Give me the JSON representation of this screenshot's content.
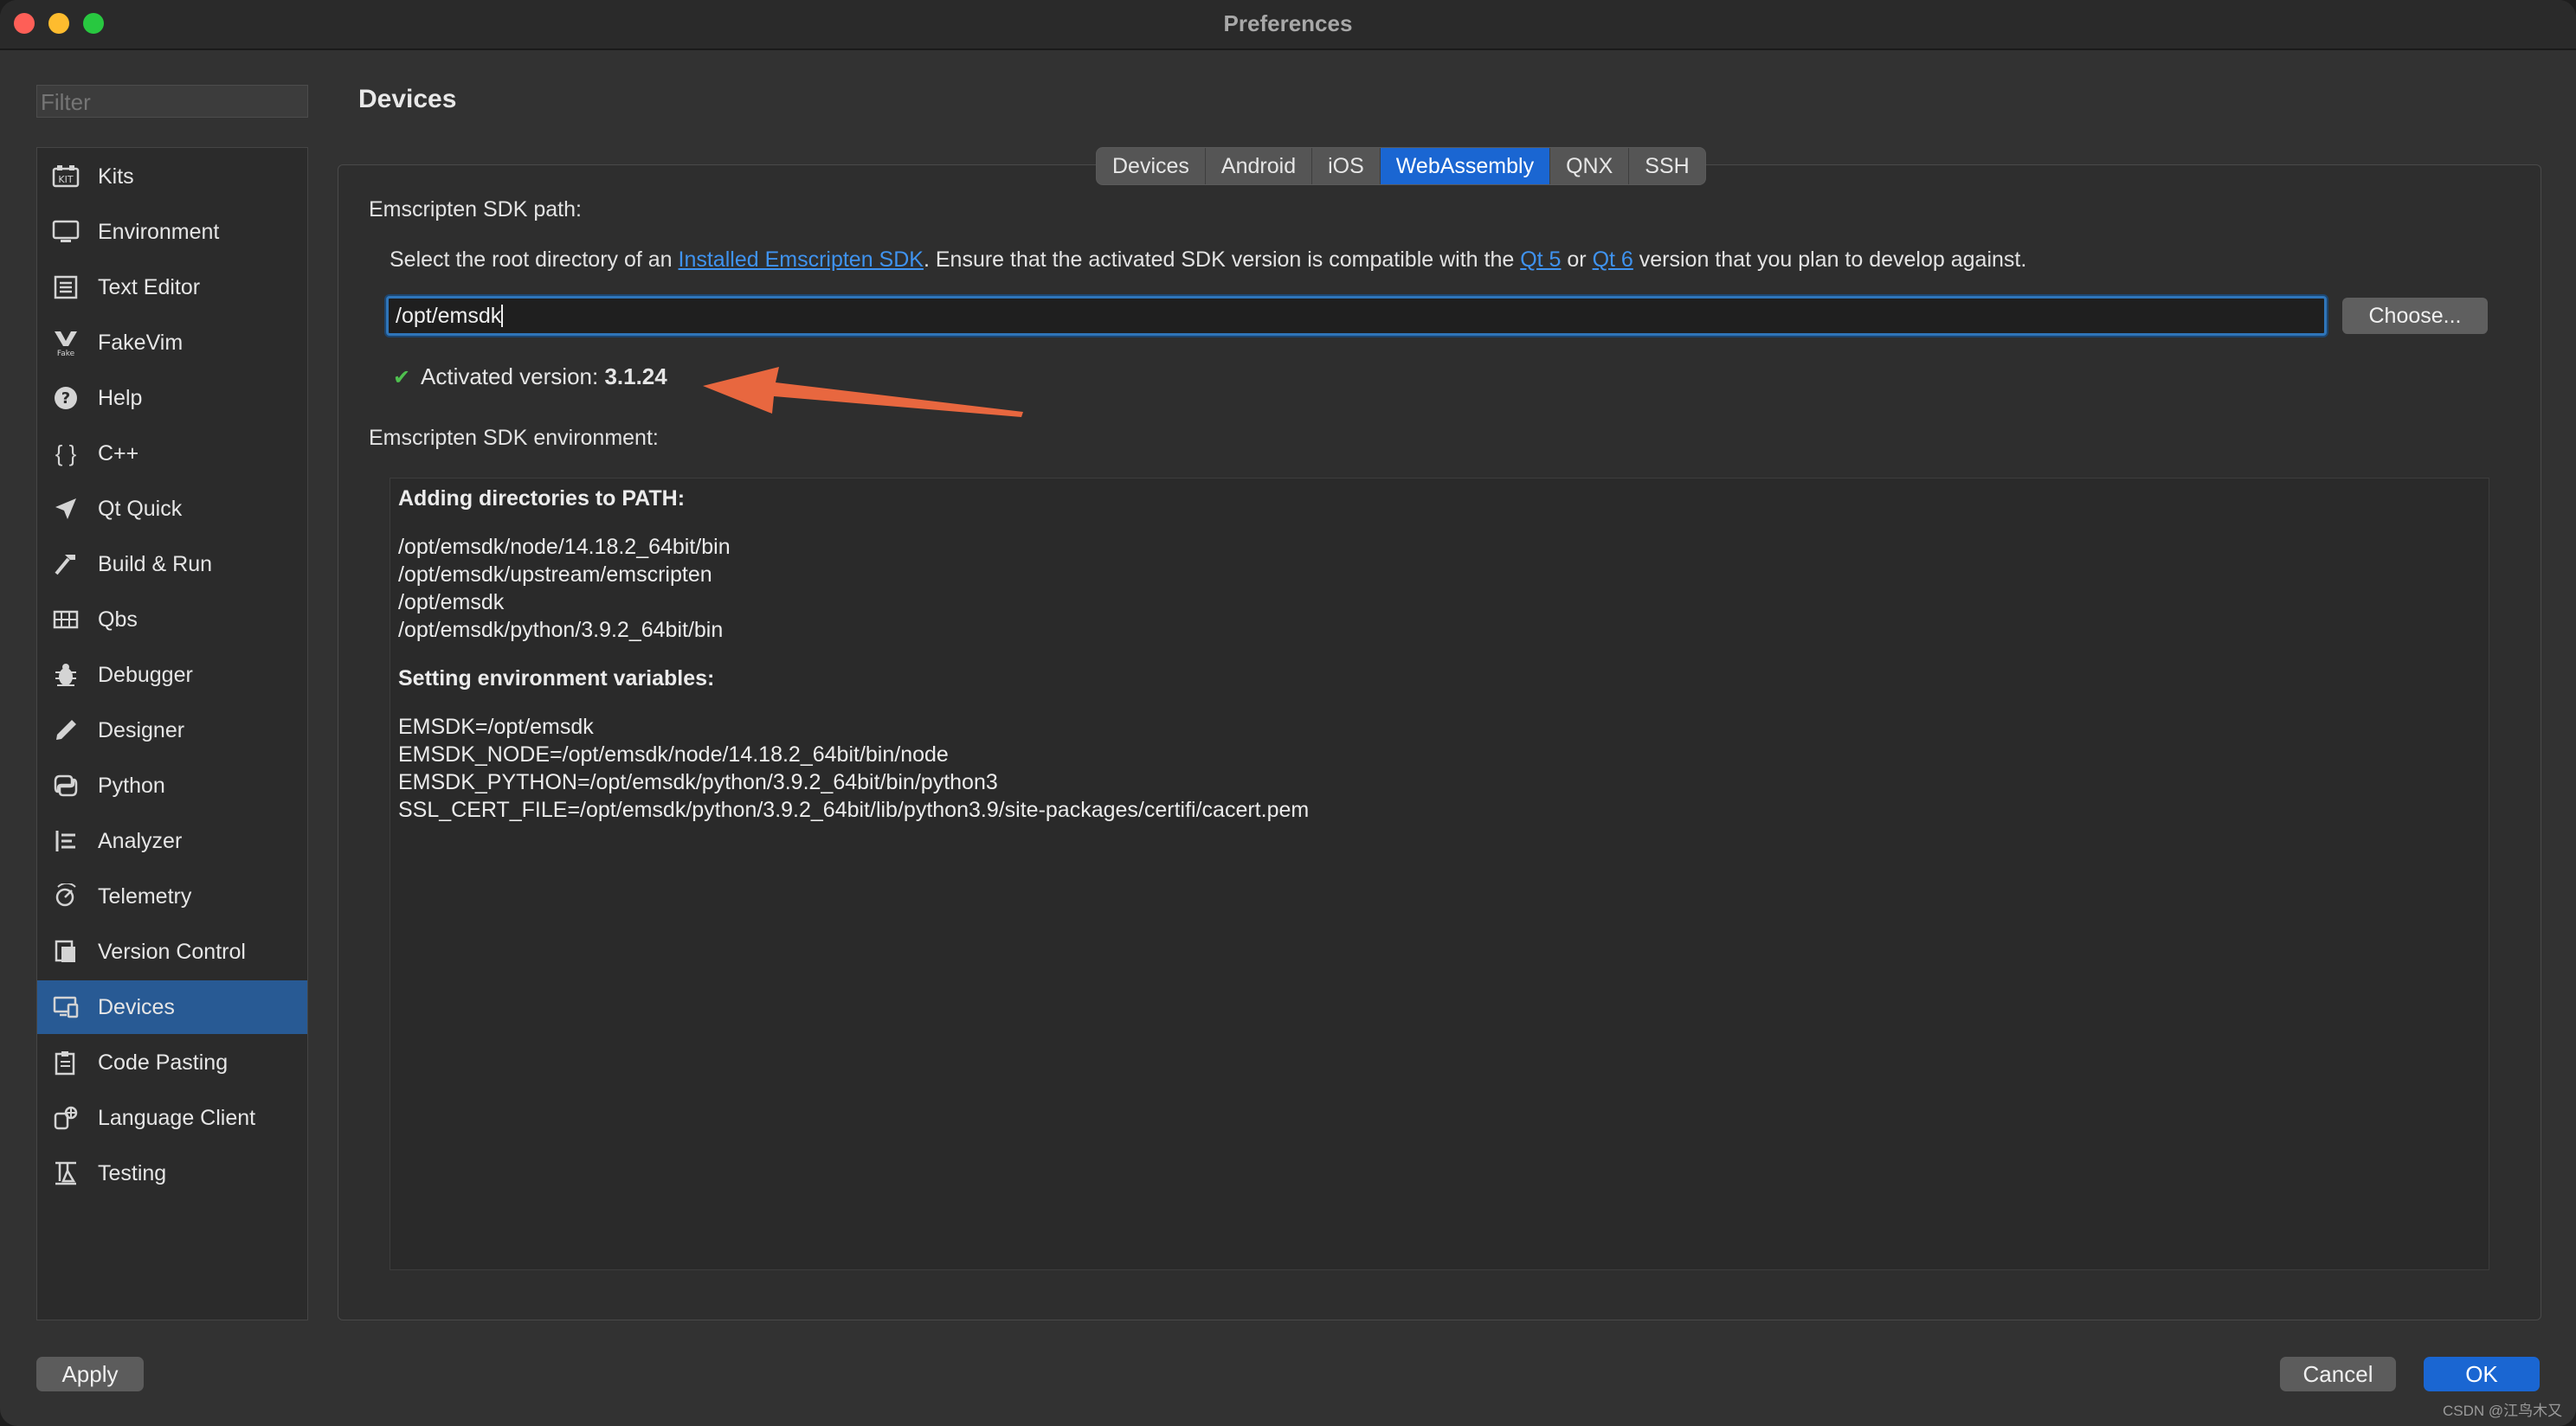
{
  "window": {
    "title": "Preferences"
  },
  "sidebar": {
    "filter_placeholder": "Filter",
    "items": [
      {
        "label": "Kits",
        "icon": "kits-icon"
      },
      {
        "label": "Environment",
        "icon": "monitor-icon"
      },
      {
        "label": "Text Editor",
        "icon": "text-editor-icon"
      },
      {
        "label": "FakeVim",
        "icon": "fakevim-icon"
      },
      {
        "label": "Help",
        "icon": "help-icon"
      },
      {
        "label": "C++",
        "icon": "braces-icon"
      },
      {
        "label": "Qt Quick",
        "icon": "send-icon"
      },
      {
        "label": "Build & Run",
        "icon": "hammer-icon"
      },
      {
        "label": "Qbs",
        "icon": "qbs-icon"
      },
      {
        "label": "Debugger",
        "icon": "bug-icon"
      },
      {
        "label": "Designer",
        "icon": "pencil-icon"
      },
      {
        "label": "Python",
        "icon": "python-icon"
      },
      {
        "label": "Analyzer",
        "icon": "analyzer-icon"
      },
      {
        "label": "Telemetry",
        "icon": "telemetry-icon"
      },
      {
        "label": "Version Control",
        "icon": "version-control-icon"
      },
      {
        "label": "Devices",
        "icon": "devices-icon"
      },
      {
        "label": "Code Pasting",
        "icon": "clipboard-icon"
      },
      {
        "label": "Language Client",
        "icon": "language-client-icon"
      },
      {
        "label": "Testing",
        "icon": "testing-icon"
      }
    ],
    "selected": "Devices"
  },
  "main": {
    "title": "Devices",
    "tabs": [
      "Devices",
      "Android",
      "iOS",
      "WebAssembly",
      "QNX",
      "SSH"
    ],
    "active_tab": "WebAssembly",
    "sdk_path_label": "Emscripten SDK path:",
    "description": {
      "part1": "Select the root directory of an ",
      "link1": "Installed Emscripten SDK",
      "part2": ". Ensure that the activated SDK version is compatible with the ",
      "link2": "Qt 5",
      "part3": " or ",
      "link3": "Qt 6",
      "part4": " version that you plan to develop against."
    },
    "sdk_path_value": "/opt/emsdk",
    "choose_label": "Choose...",
    "activated_label": "Activated version: ",
    "activated_version": "3.1.24",
    "env_label": "Emscripten SDK environment:",
    "env_path_header": "Adding directories to PATH:",
    "env_paths": [
      "/opt/emsdk/node/14.18.2_64bit/bin",
      "/opt/emsdk/upstream/emscripten",
      "/opt/emsdk",
      "/opt/emsdk/python/3.9.2_64bit/bin"
    ],
    "env_vars_header": "Setting environment variables:",
    "env_vars": [
      "EMSDK=/opt/emsdk",
      "EMSDK_NODE=/opt/emsdk/node/14.18.2_64bit/bin/node",
      "EMSDK_PYTHON=/opt/emsdk/python/3.9.2_64bit/bin/python3",
      "SSL_CERT_FILE=/opt/emsdk/python/3.9.2_64bit/lib/python3.9/site-packages/certifi/cacert.pem"
    ]
  },
  "footer": {
    "apply": "Apply",
    "cancel": "Cancel",
    "ok": "OK"
  },
  "watermark": "CSDN @江鸟木又",
  "colors": {
    "accent": "#1a66d2",
    "selected_row": "#285a94",
    "link": "#3f93f0",
    "annotation_arrow": "#e8673f",
    "check": "#4fc04f"
  }
}
